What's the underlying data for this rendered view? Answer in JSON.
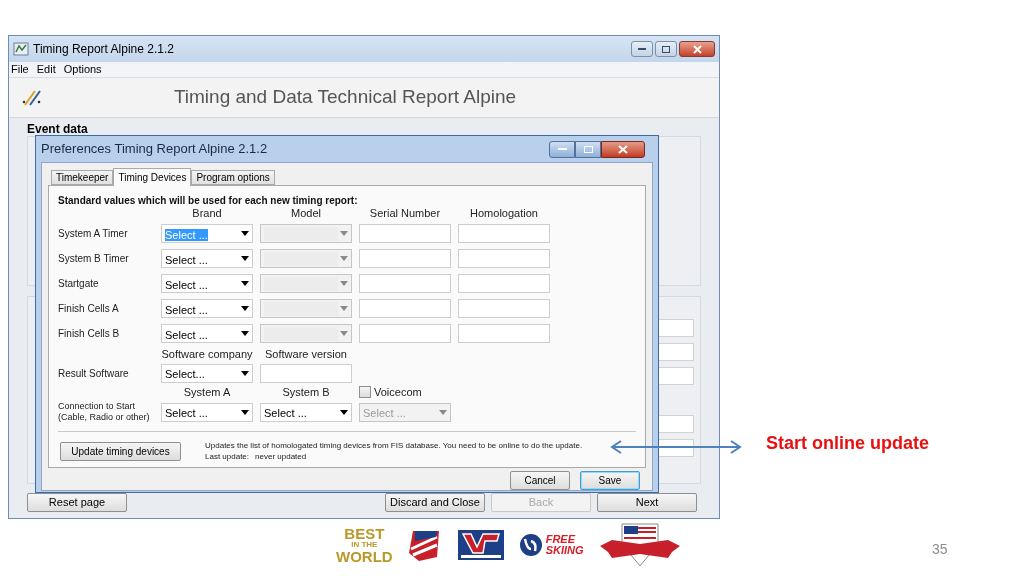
{
  "app_window": {
    "title": "Timing Report Alpine 2.1.2",
    "menu": [
      "File",
      "Edit",
      "Options"
    ],
    "header_title": "Timing and Data Technical Report Alpine",
    "section_label": "Event data",
    "bottom_buttons": [
      {
        "label": "Reset page",
        "disabled": false
      },
      {
        "label": "Discard and Close",
        "disabled": false
      },
      {
        "label": "Back",
        "disabled": true
      },
      {
        "label": "Next",
        "disabled": false
      }
    ]
  },
  "dialog": {
    "title": "Preferences Timing Report Alpine 2.1.2",
    "tabs": [
      {
        "label": "Timekeeper",
        "selected": false
      },
      {
        "label": "Timing Devices",
        "selected": true
      },
      {
        "label": "Program options",
        "selected": false
      }
    ],
    "heading": "Standard values which will be used for each new timing report:",
    "columns": [
      "Brand",
      "Model",
      "Serial Number",
      "Homologation"
    ],
    "device_rows": [
      {
        "label": "System A Timer",
        "brand": "Select ...",
        "highlighted": true
      },
      {
        "label": "System B Timer",
        "brand": "Select ...",
        "highlighted": false
      },
      {
        "label": "Startgate",
        "brand": "Select ...",
        "highlighted": false
      },
      {
        "label": "Finish Cells A",
        "brand": "Select ...",
        "highlighted": false
      },
      {
        "label": "Finish Cells B",
        "brand": "Select ...",
        "highlighted": false
      }
    ],
    "software": {
      "columns": [
        "Software company",
        "Software version"
      ],
      "label": "Result Software",
      "company": "Select..."
    },
    "connection": {
      "label_lines": [
        "Connection to Start",
        "(Cable, Radio or other)"
      ],
      "columns": [
        "System A",
        "System B"
      ],
      "system_a": "Select ...",
      "system_b": "Select ...",
      "voicecom": {
        "label": "Voicecom",
        "checked": false
      },
      "voicecom_select": {
        "value": "Select ...",
        "disabled": true
      }
    },
    "update": {
      "button": "Update timing devices",
      "description": "Updates the list of homologated timing devices from FIS database. You need to be online to do the update.",
      "last_update_label": "Last update:",
      "last_update_value": "never updated"
    },
    "buttons": [
      {
        "label": "Cancel",
        "kind": "normal"
      },
      {
        "label": "Save",
        "kind": "default"
      }
    ]
  },
  "annotation": {
    "text": "Start online update"
  },
  "logos": {
    "best": [
      "BEST",
      "IN THE",
      "WORLD"
    ],
    "freeskiing": [
      "FREE",
      "SKIING"
    ]
  },
  "slide_number": "35"
}
